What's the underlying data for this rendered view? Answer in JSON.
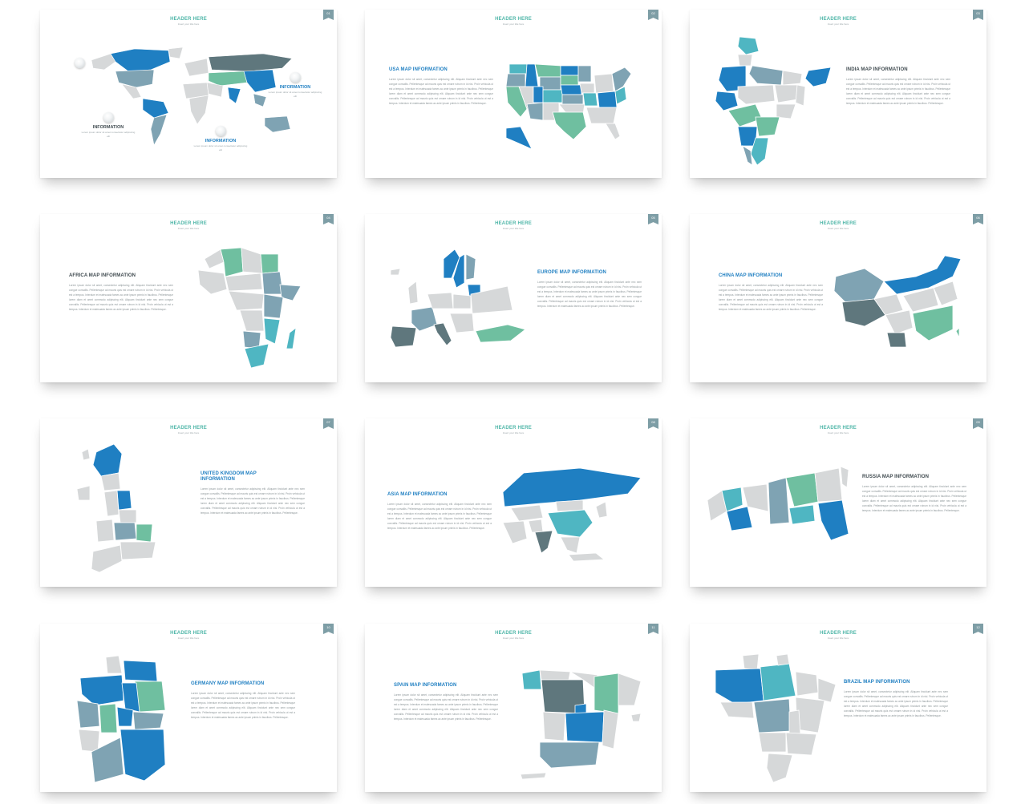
{
  "slide_header": {
    "title": "HEADER HERE",
    "subtitle": "Insert your title here"
  },
  "body_text": "Lorem ipsum dolor sit amet, consectetur adipiscing elit. Aliquam tincidunt ante nec sem congue convallis. Pellentesque ad mauris quis est ornare rutrum in id nisi. Proin vehicula ut est a tempus. Interdum et malesuada fames ac ante ipsum primis in faucibus. Pellentesque lorem diam et amet commodo adipiscing elit. Aliquam tincidunt ante nec sem congue convallis. Pellentesque ad mauris quis est ornare rutrum in id nisi. Proin vehicula ut est a tempus. Interdum et malesuada fames ac ante ipsum primis in faucibus. Pellentesque.",
  "callout_text": "Lorem ipsum dolor sit amet consectetur adipiscing elit",
  "world": {
    "callout_1": "INFORMATION",
    "callout_2": "INFORMATION",
    "callout_3": "INFORMATION"
  },
  "slides": [
    {
      "page": "01",
      "title": ""
    },
    {
      "page": "02",
      "title": "USA MAP INFORMATION"
    },
    {
      "page": "03",
      "title": "INDIA MAP INFORMATION"
    },
    {
      "page": "04",
      "title": "AFRICA MAP INFORMATION"
    },
    {
      "page": "05",
      "title": "EUROPE MAP INFORMATION"
    },
    {
      "page": "06",
      "title": "CHINA MAP INFORMATION"
    },
    {
      "page": "07",
      "title": "UNITED KINGDOM MAP INFORMATION"
    },
    {
      "page": "08",
      "title": "ASIA MAP INFORMATION"
    },
    {
      "page": "09",
      "title": "RUSSIA MAP INFORMATION"
    },
    {
      "page": "10",
      "title": "GERMANY MAP INFORMATION"
    },
    {
      "page": "11",
      "title": "SPAIN MAP INFORMATION"
    },
    {
      "page": "12",
      "title": "BRAZIL MAP INFORMATION"
    }
  ],
  "colors": {
    "blue": "#1f7fc2",
    "teal": "#4fb6c2",
    "green": "#6fbfa0",
    "slate": "#7fa3b3",
    "dark": "#5f777d",
    "grey": "#d6d8d9"
  }
}
